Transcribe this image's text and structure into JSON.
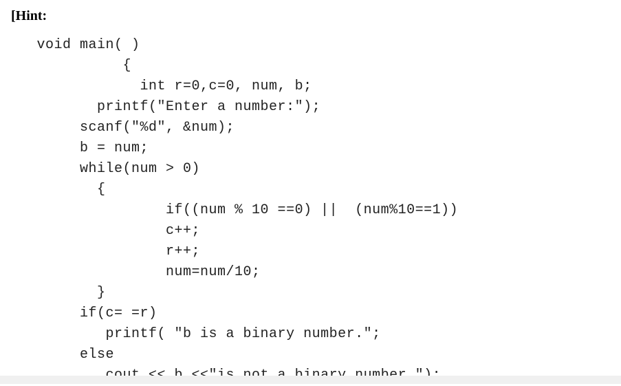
{
  "heading": "[Hint:",
  "code": {
    "line1": "   void main( )",
    "line2": "             {",
    "line3": "               int r=0,c=0, num, b;",
    "line4": "          printf(\"Enter a number:\");",
    "line5": "        scanf(\"%d\", &num);",
    "line6": "        b = num;",
    "line7": "        while(num > 0)",
    "line8": "          {",
    "line9": "                  if((num % 10 ==0) ||  (num%10==1))",
    "line10": "                  c++;",
    "line11": "                  r++;",
    "line12": "                  num=num/10;",
    "line13": "          }",
    "line14": "        if(c= =r)",
    "line15": "           printf( \"b is a binary number.\";",
    "line16": "        else",
    "line17": "           cout << b <<\"is not a binary number.\");"
  }
}
